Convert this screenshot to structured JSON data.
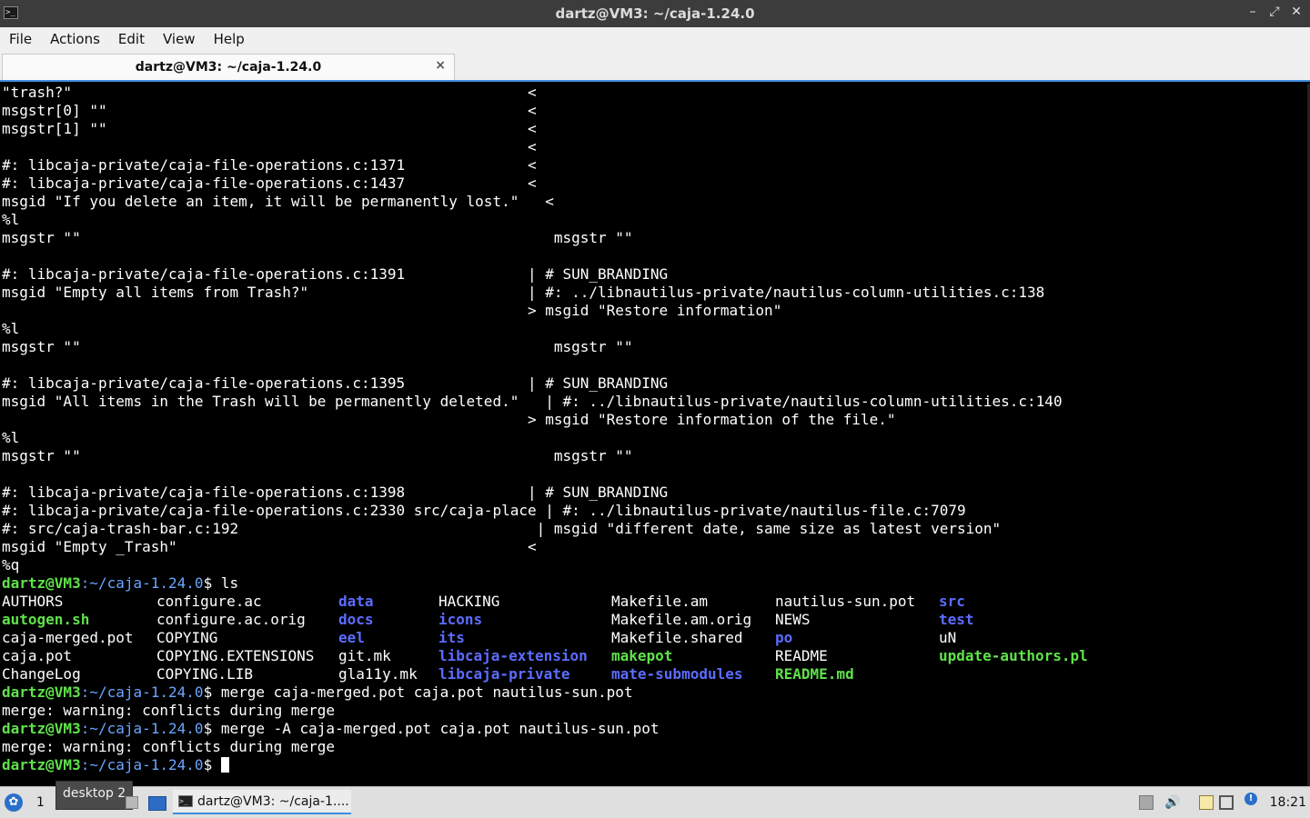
{
  "window": {
    "title": "dartz@VM3: ~/caja-1.24.0"
  },
  "menu": [
    "File",
    "Actions",
    "Edit",
    "View",
    "Help"
  ],
  "tab": {
    "label": "dartz@VM3: ~/caja-1.24.0",
    "close": "×"
  },
  "terminal": {
    "prompt_user": "dartz@VM3",
    "prompt_path": ":~/caja-1.24.0",
    "prompt_sign": "$ ",
    "diff_lines": [
      "\"trash?\"                                                    <",
      "msgstr[0] \"\"                                                <",
      "msgstr[1] \"\"                                                <",
      "                                                            <",
      "#: libcaja-private/caja-file-operations.c:1371              <",
      "#: libcaja-private/caja-file-operations.c:1437              <",
      "msgid \"If you delete an item, it will be permanently lost.\"   <",
      "%l",
      "msgstr \"\"                                                      msgstr \"\"",
      "",
      "#: libcaja-private/caja-file-operations.c:1391              | # SUN_BRANDING",
      "msgid \"Empty all items from Trash?\"                         | #: ../libnautilus-private/nautilus-column-utilities.c:138",
      "                                                            > msgid \"Restore information\"",
      "%l",
      "msgstr \"\"                                                      msgstr \"\"",
      "",
      "#: libcaja-private/caja-file-operations.c:1395              | # SUN_BRANDING",
      "msgid \"All items in the Trash will be permanently deleted.\"   | #: ../libnautilus-private/nautilus-column-utilities.c:140",
      "                                                            > msgid \"Restore information of the file.\"",
      "%l",
      "msgstr \"\"                                                      msgstr \"\"",
      "",
      "#: libcaja-private/caja-file-operations.c:1398              | # SUN_BRANDING",
      "#: libcaja-private/caja-file-operations.c:2330 src/caja-place | #: ../libnautilus-private/nautilus-file.c:7079",
      "#: src/caja-trash-bar.c:192                                  | msgid \"different date, same size as latest version\"",
      "msgid \"Empty _Trash\"                                        <",
      "%q"
    ],
    "commands": [
      "ls",
      "merge caja-merged.pot caja.pot nautilus-sun.pot",
      "merge -A caja-merged.pot caja.pot nautilus-sun.pot"
    ],
    "warning": "merge: warning: conflicts during merge",
    "ls_rows": [
      [
        "AUTHORS",
        "configure.ac",
        "data",
        "HACKING",
        "Makefile.am",
        "nautilus-sun.pot",
        "src"
      ],
      [
        "autogen.sh",
        "configure.ac.orig",
        "docs",
        "icons",
        "Makefile.am.orig",
        "NEWS",
        "test"
      ],
      [
        "caja-merged.pot",
        "COPYING",
        "eel",
        "its",
        "Makefile.shared",
        "po",
        "uN"
      ],
      [
        "caja.pot",
        "COPYING.EXTENSIONS",
        "git.mk",
        "libcaja-extension",
        "makepot",
        "README",
        "update-authors.pl"
      ],
      [
        "ChangeLog",
        "COPYING.LIB",
        "gla11y.mk",
        "libcaja-private",
        "mate-submodules",
        "README.md",
        ""
      ]
    ],
    "ls_colors": [
      [
        "w",
        "w",
        "b",
        "w",
        "w",
        "w",
        "b"
      ],
      [
        "g",
        "w",
        "b",
        "b",
        "w",
        "w",
        "b"
      ],
      [
        "w",
        "w",
        "b",
        "b",
        "w",
        "b",
        "w"
      ],
      [
        "w",
        "w",
        "w",
        "b",
        "g",
        "w",
        "g"
      ],
      [
        "w",
        "w",
        "w",
        "b",
        "b",
        "g",
        "w"
      ]
    ]
  },
  "taskbar": {
    "desktop_number": "1",
    "desktop_tooltip": "desktop 2",
    "task_label": "dartz@VM3: ~/caja-1....",
    "clock": "18:21",
    "notification_badge": "!"
  },
  "colors": {
    "prompt": "#5fe24a",
    "path": "#69a6ff",
    "dir": "#5c6cff",
    "exec": "#5fe24a",
    "accent": "#3d8ee0"
  }
}
